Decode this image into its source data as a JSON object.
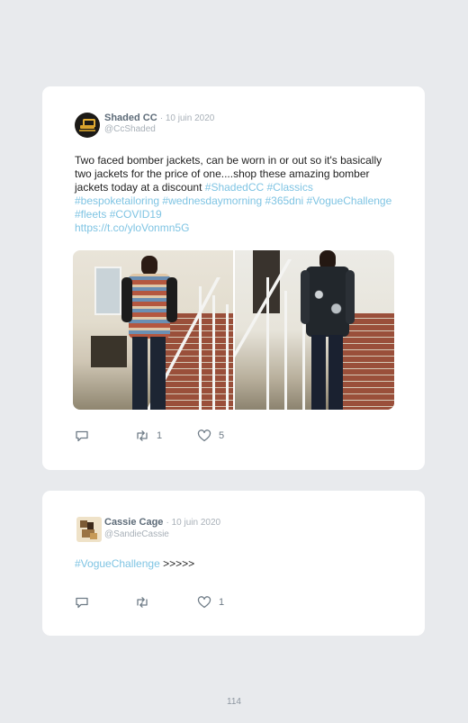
{
  "tweets": [
    {
      "name": "Shaded CC",
      "date": "· 10 juin 2020",
      "handle": "@CcShaded",
      "text": "Two faced bomber jackets, can be worn in or out so it's basically two jackets for the price of one....shop these amazing bomber jackets today at a discount",
      "hashtags": "#ShadedCC #Classics #bespoketailoring #wednesdaymorning #365dni #VogueChallenge #fleets #COVID19",
      "link": "https://t.co/yloVonmn5G",
      "retweets": "1",
      "likes": "5"
    },
    {
      "name": "Cassie Cage",
      "date": "· 10 juin 2020",
      "handle": "@SandieCassie",
      "hashtag": "#VogueChallenge",
      "text_after": " >>>>>",
      "likes": "1"
    }
  ],
  "page_number": "114",
  "colors": {
    "background": "#e8eaed",
    "card": "#ffffff",
    "link": "#7fc4e3",
    "muted": "#a8b0b8",
    "name": "#5d6b78"
  },
  "icons": [
    "reply-icon",
    "retweet-icon",
    "like-icon"
  ]
}
